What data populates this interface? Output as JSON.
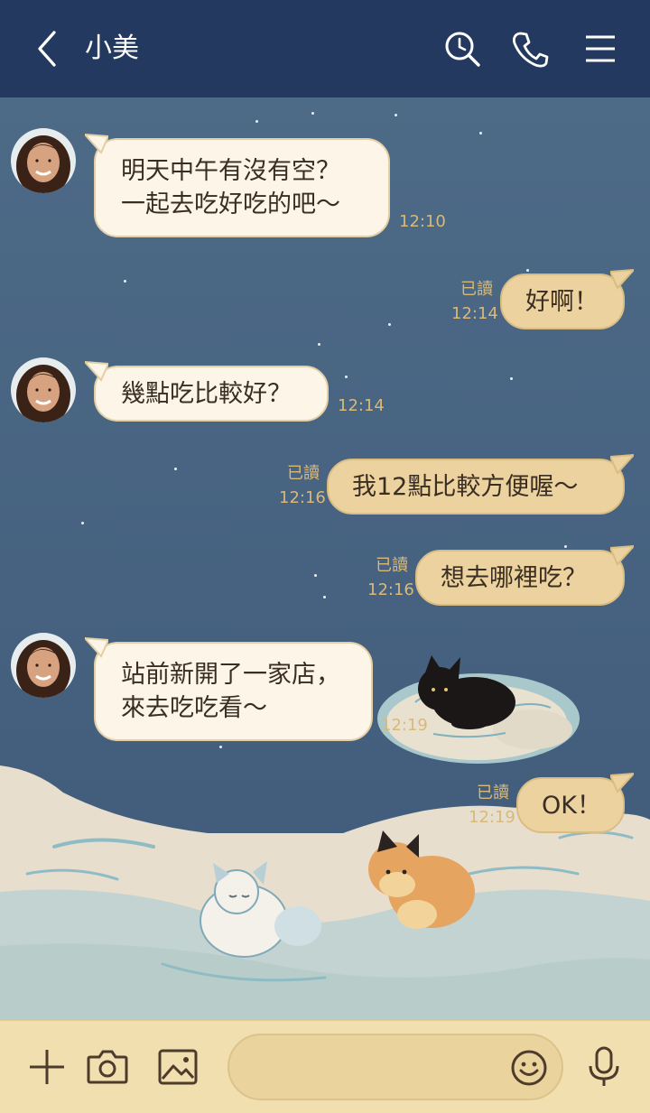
{
  "header": {
    "contact_name": "小美",
    "back_icon": "chevron-left-icon",
    "search_icon": "search-clock-icon",
    "call_icon": "phone-icon",
    "menu_icon": "menu-icon"
  },
  "messages": [
    {
      "from": "contact",
      "text": "明天中午有沒有空？\n一起去吃好吃的吧～",
      "time": "12:10"
    },
    {
      "from": "me",
      "text": "好啊！",
      "read": "已讀",
      "time": "12:14"
    },
    {
      "from": "contact",
      "text": "幾點吃比較好？",
      "time": "12:14"
    },
    {
      "from": "me",
      "text": "我12點比較方便喔～",
      "read": "已讀",
      "time": "12:16"
    },
    {
      "from": "me",
      "text": "想去哪裡吃？",
      "read": "已讀",
      "time": "12:16"
    },
    {
      "from": "contact",
      "text": "站前新開了一家店，\n來去吃吃看～",
      "time": "12:19"
    },
    {
      "from": "me",
      "text": "OK！",
      "read": "已讀",
      "time": "12:19"
    }
  ],
  "input_bar": {
    "add_icon": "plus-icon",
    "camera_icon": "camera-icon",
    "image_icon": "image-icon",
    "emoji_icon": "emoji-smile-icon",
    "mic_icon": "microphone-icon",
    "message_placeholder": ""
  },
  "colors": {
    "header_bg": "#23395f",
    "chat_bg": "#4a6583",
    "incoming_bubble": "#fdf5e8",
    "outgoing_bubble": "#ebd29e",
    "timestamp": "#d9b978",
    "input_bar_bg": "#f1dfb0"
  }
}
